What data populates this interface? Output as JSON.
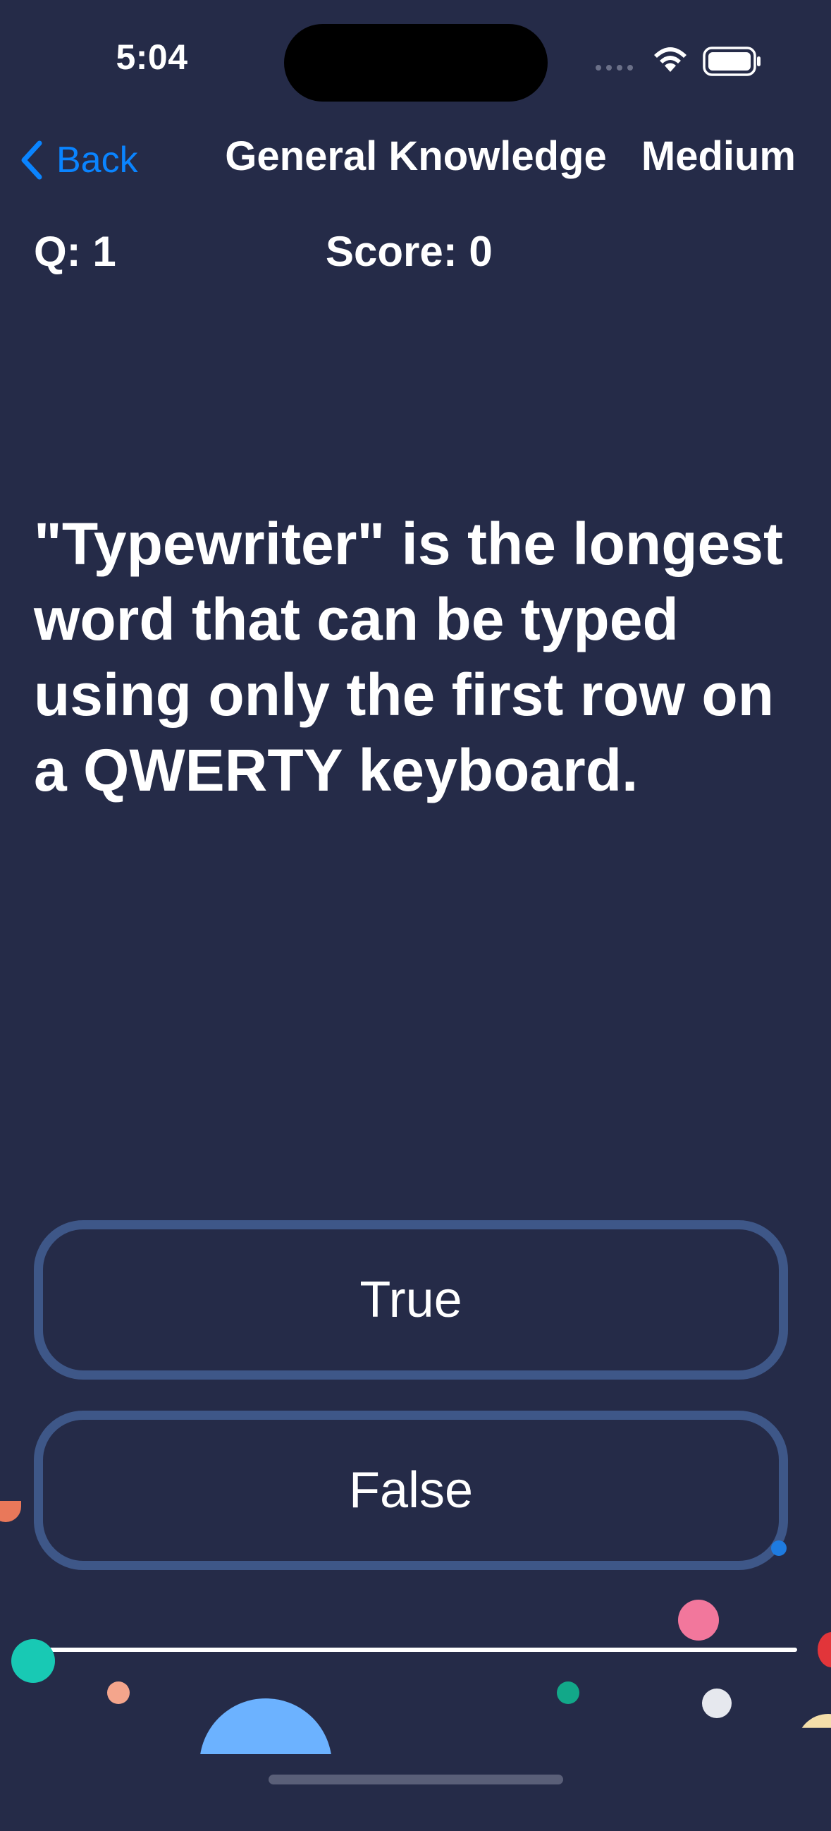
{
  "status_bar": {
    "time": "5:04",
    "icons": [
      "cellular-signal-icon",
      "wifi-icon",
      "battery-icon"
    ]
  },
  "nav": {
    "back_label": "Back",
    "title": "General Knowledge",
    "difficulty": "Medium"
  },
  "stats": {
    "question_label": "Q: 1",
    "score_label": "Score: 0"
  },
  "question": {
    "text": "\"Typewriter\" is the longest word that can be typed using only the first row on a QWERTY keyboard."
  },
  "answers": [
    {
      "label": "True"
    },
    {
      "label": "False"
    }
  ],
  "colors": {
    "background": "#252b48",
    "accent": "#0a84ff",
    "answer_border": "#3e5788",
    "text": "#ffffff"
  }
}
